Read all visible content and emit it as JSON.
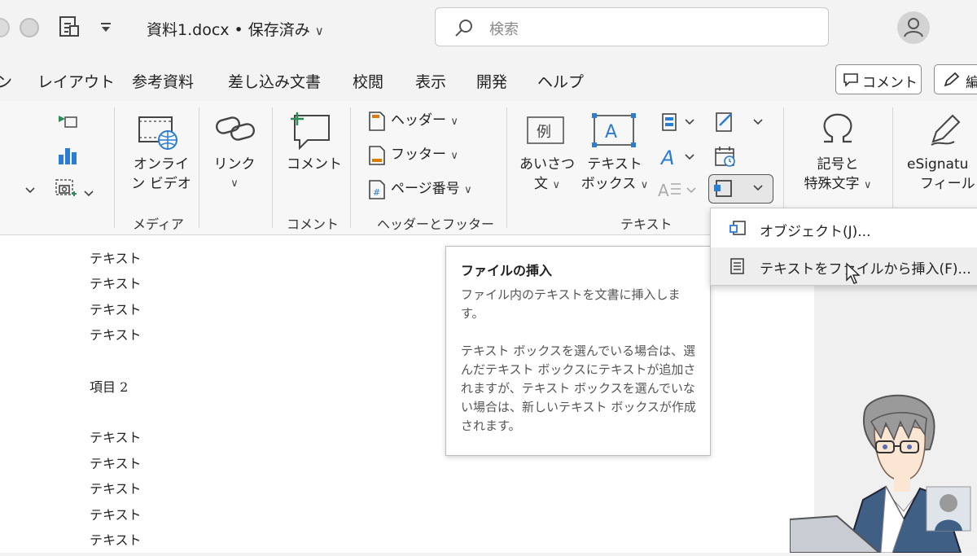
{
  "titlebar": {
    "doc_title": "資料1.docx • 保存済み",
    "search_placeholder": "検索"
  },
  "tabs": [
    "ン",
    "レイアウト",
    "参考資料",
    "差し込み文書",
    "校閲",
    "表示",
    "開発",
    "ヘルプ"
  ],
  "actions": {
    "comment_label": "コメント",
    "edit_label": "編"
  },
  "ribbon": {
    "media": {
      "online_video_line1": "オンライ",
      "online_video_line2": "ン ビデオ",
      "group_label": "メディア"
    },
    "link": {
      "label": "リンク"
    },
    "comment": {
      "label": "コメント",
      "group_label": "コメント"
    },
    "header_footer": {
      "header": "ヘッダー",
      "footer": "フッター",
      "page_number": "ページ番号",
      "group_label": "ヘッダーとフッター"
    },
    "text": {
      "greeting_line1": "あいさつ",
      "greeting_line2": "文",
      "greeting_icon_char": "例",
      "textbox_line1": "テキスト",
      "textbox_line2": "ボックス",
      "group_label": "テキスト"
    },
    "symbols": {
      "line1": "記号と",
      "line2": "特殊文字"
    },
    "esignature": {
      "line1": "eSignatu",
      "line2": "フィールド"
    }
  },
  "document": {
    "lines_top": [
      "テキスト",
      "テキスト",
      "テキスト",
      "テキスト"
    ],
    "heading": "項目 2",
    "lines_bottom": [
      "テキスト",
      "テキスト",
      "テキスト",
      "テキスト",
      "テキスト"
    ]
  },
  "tooltip": {
    "title": "ファイルの挿入",
    "para1": "ファイル内のテキストを文書に挿入します。",
    "para2": "テキスト ボックスを選んでいる場合は、選んだテキスト ボックスにテキストが追加されますが、テキスト ボックスを選んでいない場合は、新しいテキスト ボックスが作成されます。"
  },
  "menu": {
    "items": [
      {
        "label": "オブジェクト(J)..."
      },
      {
        "label": "テキストをファイルから挿入(F)..."
      }
    ]
  },
  "colors": {
    "accent_blue": "#2b7cd3",
    "accent_green": "#2e8b57"
  }
}
